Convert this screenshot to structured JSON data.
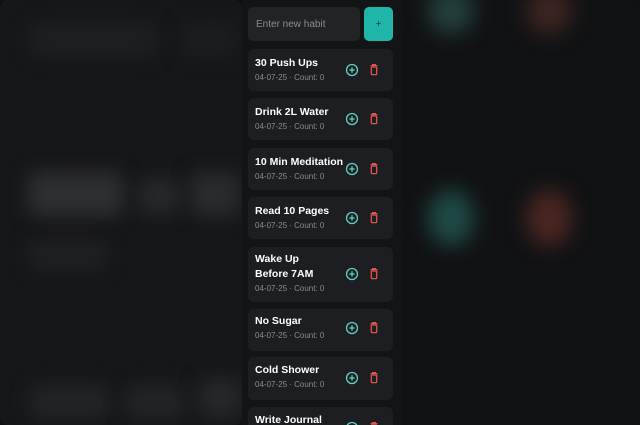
{
  "theme": {
    "accent": "#1fb5a8",
    "increment_icon_color": "#5fd1c2",
    "delete_icon_color": "#e0544a",
    "card_bg": "#1d1e21",
    "panel_bg": "#131416"
  },
  "new_habit": {
    "placeholder": "Enter new habit",
    "value": "",
    "add_button_label": "+",
    "add_button_icon": "plus-icon"
  },
  "habits": [
    {
      "name": "30 Push Ups",
      "date": "04-07-25",
      "count_label": "Count: 0",
      "meta": "04-07-25 · Count: 0",
      "increment_icon": "plus-circle-icon",
      "delete_icon": "trash-icon"
    },
    {
      "name": "Drink 2L Water",
      "date": "04-07-25",
      "count_label": "Count: 0",
      "meta": "04-07-25 · Count: 0",
      "increment_icon": "plus-circle-icon",
      "delete_icon": "trash-icon"
    },
    {
      "name": "10 Min Meditation",
      "date": "04-07-25",
      "count_label": "Count: 0",
      "meta": "04-07-25 · Count: 0",
      "increment_icon": "plus-circle-icon",
      "delete_icon": "trash-icon"
    },
    {
      "name": "Read 10 Pages",
      "date": "04-07-25",
      "count_label": "Count: 0",
      "meta": "04-07-25 · Count: 0",
      "increment_icon": "plus-circle-icon",
      "delete_icon": "trash-icon"
    },
    {
      "name": "Wake Up Before 7AM",
      "date": "04-07-25",
      "count_label": "Count: 0",
      "meta": "04-07-25 · Count: 0",
      "increment_icon": "plus-circle-icon",
      "delete_icon": "trash-icon"
    },
    {
      "name": "No Sugar",
      "date": "04-07-25",
      "count_label": "Count: 0",
      "meta": "04-07-25 · Count: 0",
      "increment_icon": "plus-circle-icon",
      "delete_icon": "trash-icon"
    },
    {
      "name": "Cold Shower",
      "date": "04-07-25",
      "count_label": "Count: 0",
      "meta": "04-07-25 · Count: 0",
      "increment_icon": "plus-circle-icon",
      "delete_icon": "trash-icon"
    },
    {
      "name": "Write Journal",
      "date": "",
      "count_label": "",
      "meta": "",
      "increment_icon": "plus-circle-icon",
      "delete_icon": "trash-icon"
    }
  ]
}
